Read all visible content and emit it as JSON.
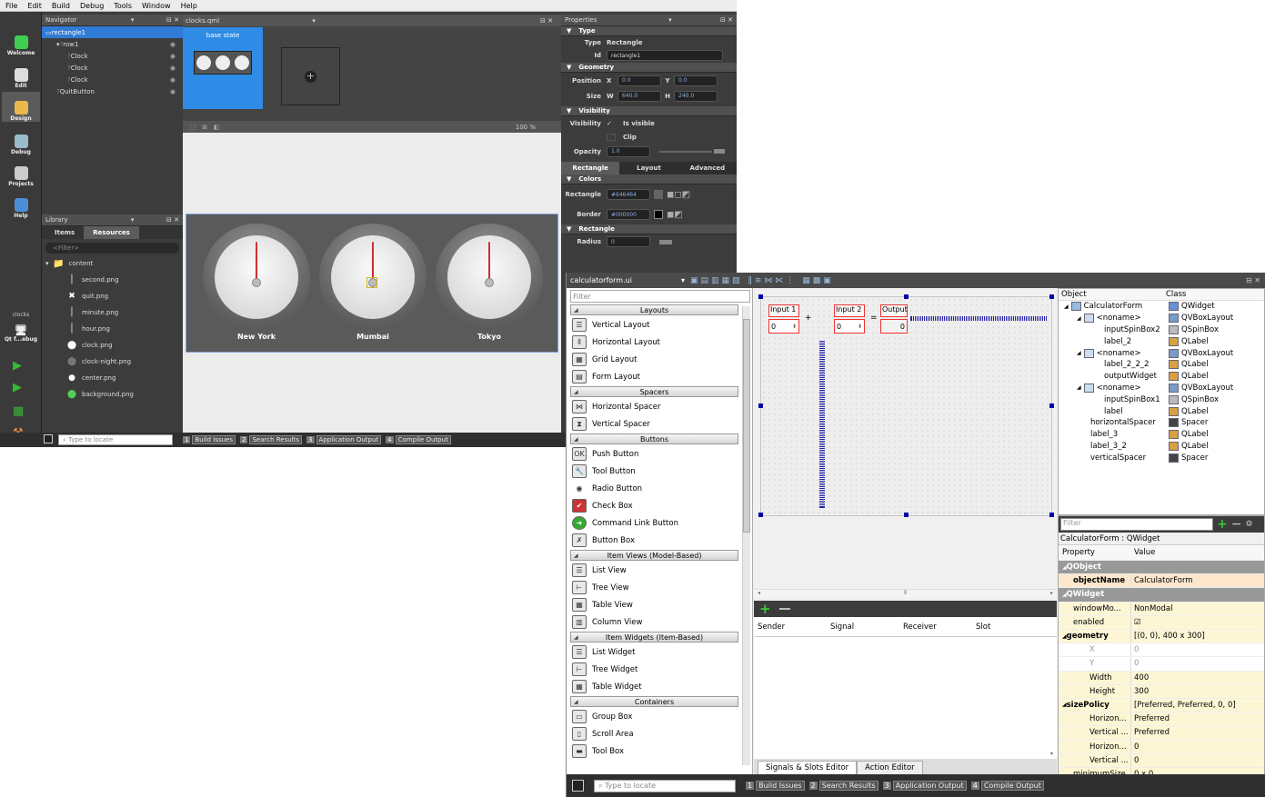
{
  "menu": [
    "File",
    "Edit",
    "Build",
    "Debug",
    "Tools",
    "Window",
    "Help"
  ],
  "modes": [
    {
      "label": "Welcome",
      "icon": "qt-logo-icon",
      "color": "#41cd52"
    },
    {
      "label": "Edit",
      "icon": "edit-icon",
      "color": "#ddd"
    },
    {
      "label": "Design",
      "icon": "design-icon",
      "color": "#e8b84a"
    },
    {
      "label": "Debug",
      "icon": "debug-icon",
      "color": "#9bc"
    },
    {
      "label": "Projects",
      "icon": "projects-icon",
      "color": "#ccc"
    },
    {
      "label": "Help",
      "icon": "help-icon",
      "color": "#4a8fd6"
    }
  ],
  "project_label": "clocks",
  "project_target": "Qt f...ebug",
  "navigator": {
    "title": "Navigator",
    "items": [
      {
        "label": "rectangle1",
        "indent": 0,
        "selected": true
      },
      {
        "label": "row1",
        "indent": 1
      },
      {
        "label": "Clock",
        "indent": 2
      },
      {
        "label": "Clock",
        "indent": 2
      },
      {
        "label": "Clock",
        "indent": 2
      },
      {
        "label": "QuitButton",
        "indent": 1
      }
    ]
  },
  "library": {
    "title": "Library",
    "tab_items": "Items",
    "tab_resources": "Resources",
    "filter_placeholder": "<Filter>",
    "items": [
      "content",
      "second.png",
      "quit.png",
      "minute.png",
      "hour.png",
      "clock.png",
      "clock-night.png",
      "center.png",
      "background.png"
    ]
  },
  "editor": {
    "file": "clocks.qml",
    "state": "base state",
    "zoom": "100 %",
    "cities": [
      "New York",
      "Mumbai",
      "Tokyo"
    ]
  },
  "properties": {
    "title": "Properties",
    "type_section": "Type",
    "type_label": "Type",
    "type_value": "Rectangle",
    "id_label": "Id",
    "id_value": "rectangle1",
    "geometry_section": "Geometry",
    "position_label": "Position",
    "x_label": "X",
    "x_value": "0.0",
    "y_label": "Y",
    "y_value": "0.0",
    "size_label": "Size",
    "w_label": "W",
    "w_value": "640.0",
    "h_label": "H",
    "h_value": "240.0",
    "visibility_section": "Visibility",
    "visibility_label": "Visibility",
    "is_visible": "Is visible",
    "clip": "Clip",
    "opacity_label": "Opacity",
    "opacity_value": "1.0",
    "tabs": [
      "Rectangle",
      "Layout",
      "Advanced"
    ],
    "colors_section": "Colors",
    "rectangle_label": "Rectangle",
    "rectangle_color": "#646464",
    "border_label": "Border",
    "border_color": "#000000",
    "rect_section": "Rectangle",
    "radius_label": "Radius",
    "radius_value": "0"
  },
  "w1status": {
    "locate_placeholder": "Type to locate",
    "panes": [
      {
        "num": "1",
        "label": "Build Issues"
      },
      {
        "num": "2",
        "label": "Search Results"
      },
      {
        "num": "3",
        "label": "Application Output"
      },
      {
        "num": "4",
        "label": "Compile Output"
      }
    ]
  },
  "designer": {
    "file": "calculatorform.ui",
    "filter_placeholder": "Filter",
    "widgetbox": [
      {
        "cat": "Layouts",
        "items": [
          "Vertical Layout",
          "Horizontal Layout",
          "Grid Layout",
          "Form Layout"
        ]
      },
      {
        "cat": "Spacers",
        "items": [
          "Horizontal Spacer",
          "Vertical Spacer"
        ]
      },
      {
        "cat": "Buttons",
        "items": [
          "Push Button",
          "Tool Button",
          "Radio Button",
          "Check Box",
          "Command Link Button",
          "Button Box"
        ]
      },
      {
        "cat": "Item Views (Model-Based)",
        "items": [
          "List View",
          "Tree View",
          "Table View",
          "Column View"
        ]
      },
      {
        "cat": "Item Widgets (Item-Based)",
        "items": [
          "List Widget",
          "Tree Widget",
          "Table Widget"
        ]
      },
      {
        "cat": "Containers",
        "items": [
          "Group Box",
          "Scroll Area",
          "Tool Box"
        ]
      }
    ],
    "form": {
      "input1": "Input 1",
      "input2": "Input 2",
      "output": "Output",
      "plus": "+",
      "equals": "=",
      "spin1": "0",
      "spin2": "0",
      "outval": "0"
    },
    "signals": {
      "cols": [
        "Sender",
        "Signal",
        "Receiver",
        "Slot"
      ],
      "tab1": "Signals & Slots Editor",
      "tab2": "Action Editor"
    },
    "object_inspector": {
      "col_object": "Object",
      "col_class": "Class",
      "rows": [
        {
          "name": "CalculatorForm",
          "cls": "QWidget",
          "indent": 0
        },
        {
          "name": "<noname>",
          "cls": "QVBoxLayout",
          "indent": 1
        },
        {
          "name": "inputSpinBox2",
          "cls": "QSpinBox",
          "indent": 2
        },
        {
          "name": "label_2",
          "cls": "QLabel",
          "indent": 2
        },
        {
          "name": "<noname>",
          "cls": "QVBoxLayout",
          "indent": 1
        },
        {
          "name": "label_2_2_2",
          "cls": "QLabel",
          "indent": 2
        },
        {
          "name": "outputWidget",
          "cls": "QLabel",
          "indent": 2
        },
        {
          "name": "<noname>",
          "cls": "QVBoxLayout",
          "indent": 1
        },
        {
          "name": "inputSpinBox1",
          "cls": "QSpinBox",
          "indent": 2
        },
        {
          "name": "label",
          "cls": "QLabel",
          "indent": 2
        },
        {
          "name": "horizontalSpacer",
          "cls": "Spacer",
          "indent": 1
        },
        {
          "name": "label_3",
          "cls": "QLabel",
          "indent": 1
        },
        {
          "name": "label_3_2",
          "cls": "QLabel",
          "indent": 1
        },
        {
          "name": "verticalSpacer",
          "cls": "Spacer",
          "indent": 1
        }
      ]
    },
    "property_editor": {
      "filter_placeholder": "Filter",
      "context": "CalculatorForm : QWidget",
      "col_property": "Property",
      "col_value": "Value",
      "rows": [
        {
          "k": "QObject",
          "v": "",
          "t": "grp"
        },
        {
          "k": "objectName",
          "v": "CalculatorForm",
          "t": "org"
        },
        {
          "k": "QWidget",
          "v": "",
          "t": "grp"
        },
        {
          "k": "windowMo...",
          "v": "NonModal",
          "t": "yel"
        },
        {
          "k": "enabled",
          "v": "☑",
          "t": "yel"
        },
        {
          "k": "geometry",
          "v": "[(0, 0), 400 x 300]",
          "t": "yel"
        },
        {
          "k": "X",
          "v": "0",
          "t": "dis"
        },
        {
          "k": "Y",
          "v": "0",
          "t": "dis"
        },
        {
          "k": "Width",
          "v": "400",
          "t": "yel"
        },
        {
          "k": "Height",
          "v": "300",
          "t": "yel"
        },
        {
          "k": "sizePolicy",
          "v": "[Preferred, Preferred, 0, 0]",
          "t": "yel"
        },
        {
          "k": "Horizon...",
          "v": "Preferred",
          "t": "yel"
        },
        {
          "k": "Vertical ...",
          "v": "Preferred",
          "t": "yel"
        },
        {
          "k": "Horizon...",
          "v": "0",
          "t": "yel"
        },
        {
          "k": "Vertical ...",
          "v": "0",
          "t": "yel"
        },
        {
          "k": "minimumSize",
          "v": "0 x 0",
          "t": "yel"
        }
      ]
    },
    "status": {
      "locate_placeholder": "Type to locate",
      "panes": [
        {
          "num": "1",
          "label": "Build Issues"
        },
        {
          "num": "2",
          "label": "Search Results"
        },
        {
          "num": "3",
          "label": "Application Output"
        },
        {
          "num": "4",
          "label": "Compile Output"
        }
      ]
    }
  }
}
